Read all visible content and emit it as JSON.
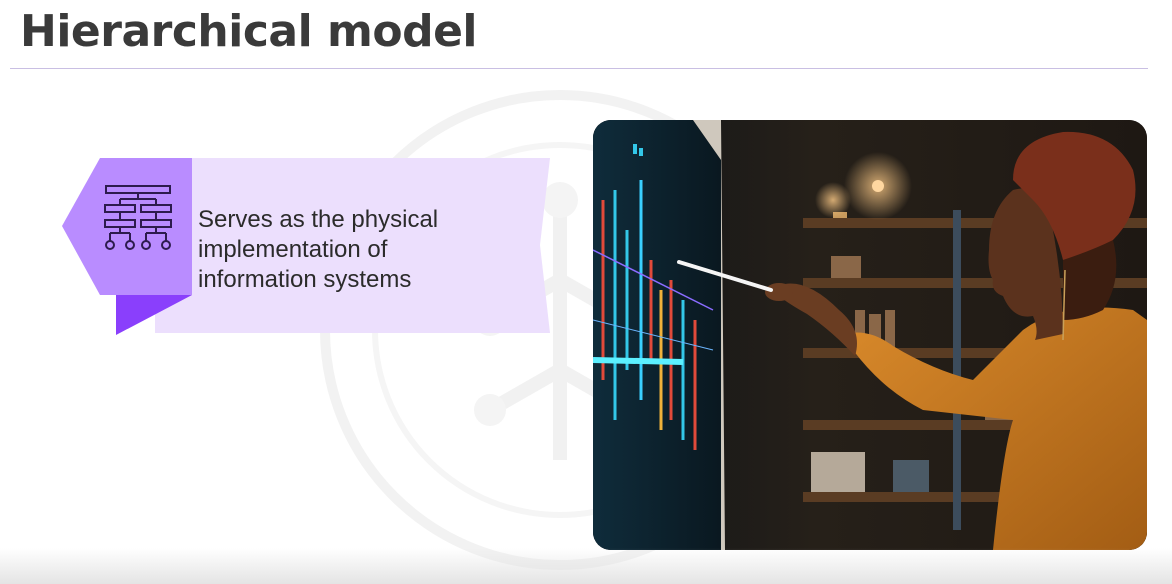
{
  "slide": {
    "title": "Hierarchical model",
    "callout": {
      "icon": "hierarchy-tree-icon",
      "lines": [
        "Serves as the physical",
        "implementation of",
        "information systems"
      ]
    },
    "photo": {
      "subject": "woman-pointing-at-screen-image"
    },
    "colors": {
      "accent_purple": "#a77bff",
      "accent_light": "#e6d9fd",
      "accent_dark": "#8a3ffc",
      "title_text": "#3a3a3a",
      "rule": "#c9bfe3"
    }
  }
}
